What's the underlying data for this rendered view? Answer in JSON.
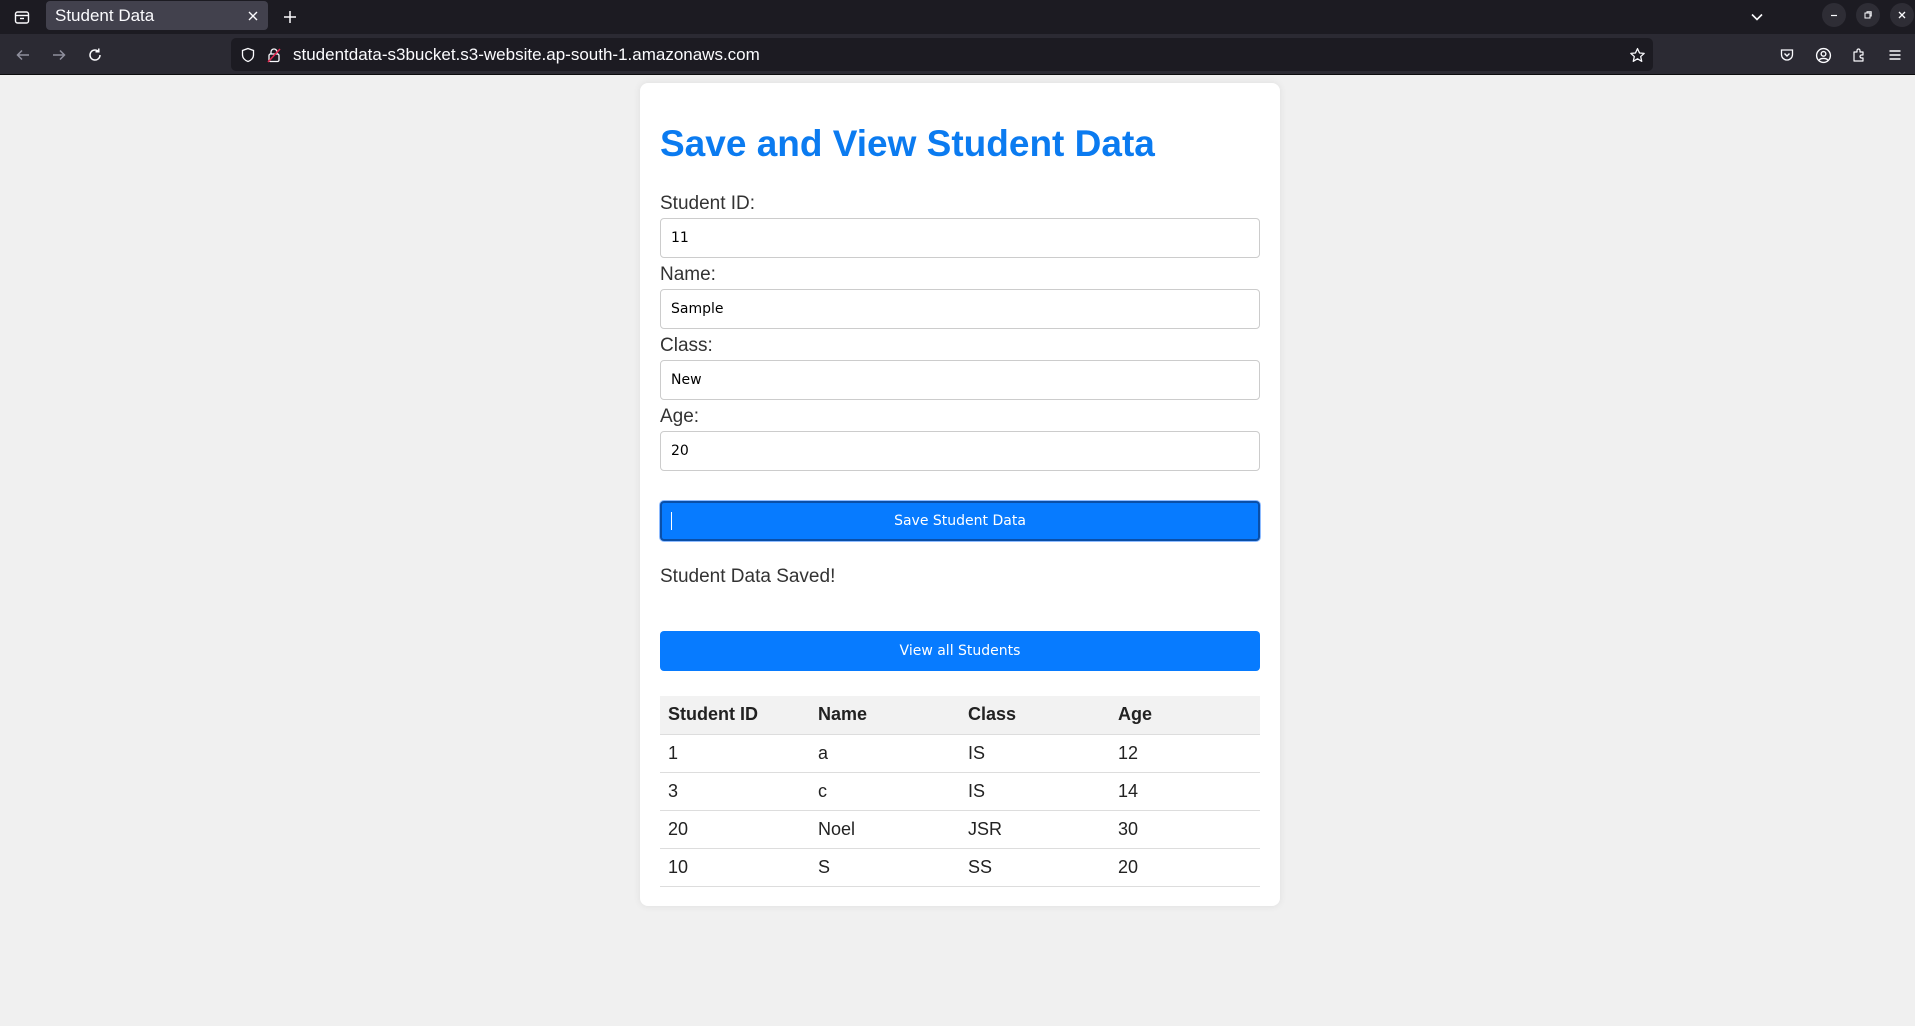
{
  "browser": {
    "tab_title": "Student Data",
    "url": "studentdata-s3bucket.s3-website.ap-south-1.amazonaws.com"
  },
  "page": {
    "title": "Save and View Student Data",
    "fields": {
      "student_id": {
        "label": "Student ID:",
        "value": "11"
      },
      "name": {
        "label": "Name:",
        "value": "Sample"
      },
      "class": {
        "label": "Class:",
        "value": "New"
      },
      "age": {
        "label": "Age:",
        "value": "20"
      }
    },
    "save_button": "Save Student Data",
    "status_message": "Student Data Saved!",
    "view_button": "View all Students",
    "table": {
      "headers": [
        "Student ID",
        "Name",
        "Class",
        "Age"
      ],
      "rows": [
        [
          "1",
          "a",
          "IS",
          "12"
        ],
        [
          "3",
          "c",
          "IS",
          "14"
        ],
        [
          "20",
          "Noel",
          "JSR",
          "30"
        ],
        [
          "10",
          "S",
          "SS",
          "20"
        ]
      ]
    }
  },
  "colors": {
    "accent": "#077bff",
    "title": "#0b7bf0",
    "page_background": "#f0f0f0"
  }
}
